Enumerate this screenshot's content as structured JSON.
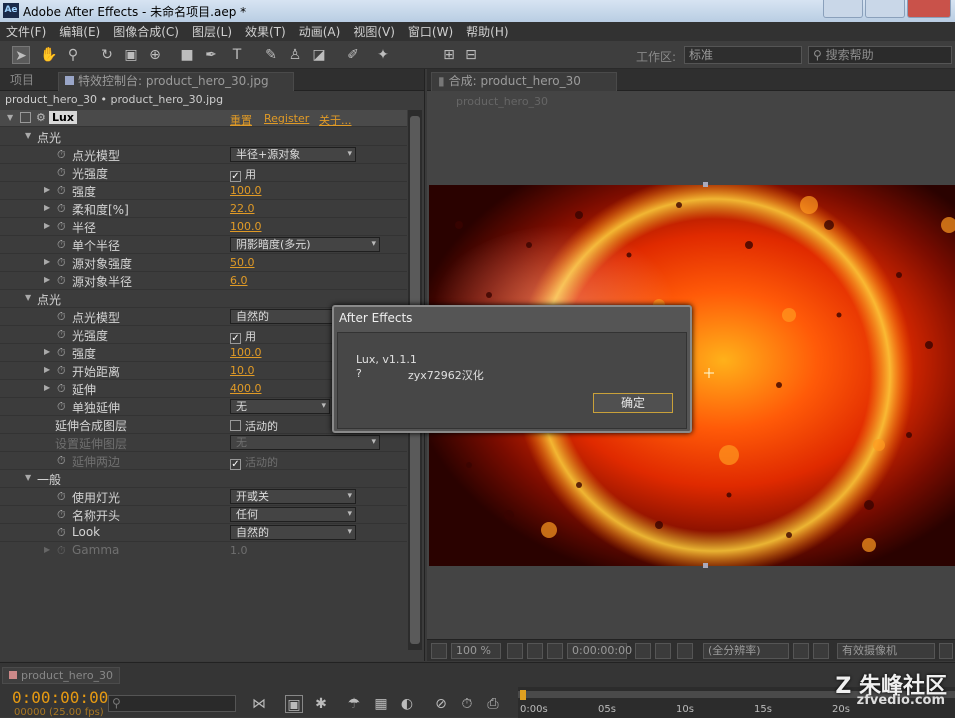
{
  "window": {
    "app_icon": "Ae",
    "title": "Adobe After Effects - 未命名项目.aep *"
  },
  "menu": [
    "文件(F)",
    "编辑(E)",
    "图像合成(C)",
    "图层(L)",
    "效果(T)",
    "动画(A)",
    "视图(V)",
    "窗口(W)",
    "帮助(H)"
  ],
  "toolbar": {
    "workspace_label": "工作区:",
    "workspace_value": "标准",
    "search_placeholder": "搜索帮助"
  },
  "left_panel": {
    "tabs": [
      "项目",
      "特效控制台: product_hero_30.jpg"
    ],
    "layer_path": "product_hero_30 • product_hero_30.jpg",
    "effect": {
      "name": "Lux",
      "reset": "重置",
      "register": "Register",
      "about": "关于..."
    },
    "rows": [
      {
        "type": "group",
        "label": "点光"
      },
      {
        "type": "dropdown",
        "label": "点光模型",
        "value": "半径+源对象"
      },
      {
        "type": "check",
        "label": "光强度",
        "value": "用",
        "checked": true
      },
      {
        "type": "number",
        "label": "强度",
        "value": "100.0"
      },
      {
        "type": "number",
        "label": "柔和度[%]",
        "value": "22.0"
      },
      {
        "type": "number",
        "label": "半径",
        "value": "100.0"
      },
      {
        "type": "dropdown",
        "label": "单个半径",
        "value": "阴影暗度(多元)"
      },
      {
        "type": "number",
        "label": "源对象强度",
        "value": "50.0"
      },
      {
        "type": "number",
        "label": "源对象半径",
        "value": "6.0"
      },
      {
        "type": "group",
        "label": "点光"
      },
      {
        "type": "dropdown",
        "label": "点光模型",
        "value": "自然的"
      },
      {
        "type": "check",
        "label": "光强度",
        "value": "用",
        "checked": true
      },
      {
        "type": "number",
        "label": "强度",
        "value": "100.0"
      },
      {
        "type": "number",
        "label": "开始距离",
        "value": "10.0"
      },
      {
        "type": "number",
        "label": "延伸",
        "value": "400.0"
      },
      {
        "type": "dropdown",
        "label": "单独延伸",
        "value": "无"
      },
      {
        "type": "check",
        "label": "延伸合成图层",
        "value": "活动的",
        "checked": false
      },
      {
        "type": "dropdown",
        "label": "设置延伸图层",
        "value": "无",
        "dim": true
      },
      {
        "type": "check",
        "label": "延伸两边",
        "value": "活动的",
        "checked": true,
        "dim": true
      },
      {
        "type": "group",
        "label": "一般"
      },
      {
        "type": "dropdown",
        "label": "使用灯光",
        "value": "开或关"
      },
      {
        "type": "dropdown",
        "label": "名称开头",
        "value": "任何"
      },
      {
        "type": "dropdown",
        "label": "Look",
        "value": "自然的"
      },
      {
        "type": "number",
        "label": "Gamma",
        "value": "1.0",
        "dim": true
      }
    ]
  },
  "comp_panel": {
    "tab": "合成: product_hero_30",
    "subtitle": "product_hero_30",
    "zoom": "100 %",
    "timecode": "0:00:00:00",
    "resolution": "(全分辨率)",
    "camera": "有效摄像机"
  },
  "dialog": {
    "title": "After Effects",
    "line1": "Lux, v1.1.1",
    "line2a": "?",
    "line2b": "zyx72962汉化",
    "ok": "确定"
  },
  "timeline": {
    "tab": "product_hero_30",
    "timecode": "0:00:00:00",
    "fps": "00000 (25.00 fps)",
    "ruler": [
      "0:00s",
      "05s",
      "10s",
      "15s",
      "20s"
    ]
  },
  "watermark": {
    "text": "朱峰社区",
    "sub": "zfvedio.com"
  },
  "colors": {
    "accent_orange": "#e09a26",
    "panel": "#3c3c3c",
    "dialog_border": "#c9a13a"
  }
}
